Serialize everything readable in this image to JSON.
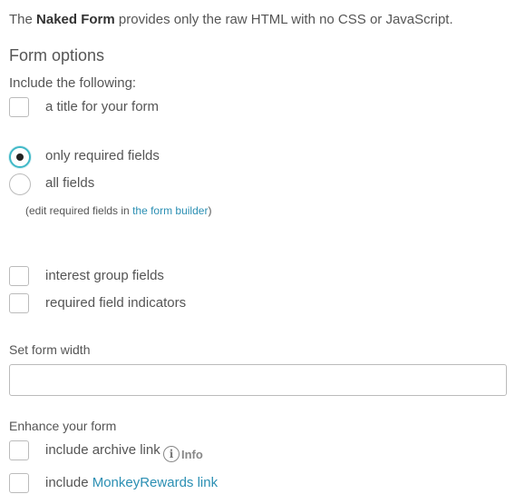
{
  "intro": {
    "prefix": "The ",
    "strong": "Naked Form",
    "suffix": " provides only the raw HTML with no CSS or JavaScript."
  },
  "form_options": {
    "title": "Form options",
    "include_label": "Include the following:",
    "title_checkbox": {
      "label": "a title for your form",
      "checked": false
    },
    "field_radios": [
      {
        "label": "only required fields",
        "checked": true
      },
      {
        "label": "all fields",
        "checked": false
      }
    ],
    "note": {
      "prefix": "(edit required fields in ",
      "link": "the form builder",
      "suffix": ")"
    },
    "interest_groups_checkbox": {
      "label": "interest group fields",
      "checked": false
    },
    "required_indicators_checkbox": {
      "label": "required field indicators",
      "checked": false
    }
  },
  "width": {
    "label": "Set form width",
    "value": ""
  },
  "enhance": {
    "label": "Enhance your form",
    "archive_checkbox": {
      "label": "include archive link",
      "checked": false
    },
    "info": {
      "icon": "info-icon",
      "glyph": "i",
      "label": "Info"
    },
    "rewards_checkbox": {
      "prefix": "include ",
      "link": "MonkeyRewards link",
      "checked": false
    }
  },
  "colors": {
    "text": "#555555",
    "link": "#2b8fb3",
    "radio_accent": "#3fb8c7",
    "border": "#bbbbbb"
  }
}
